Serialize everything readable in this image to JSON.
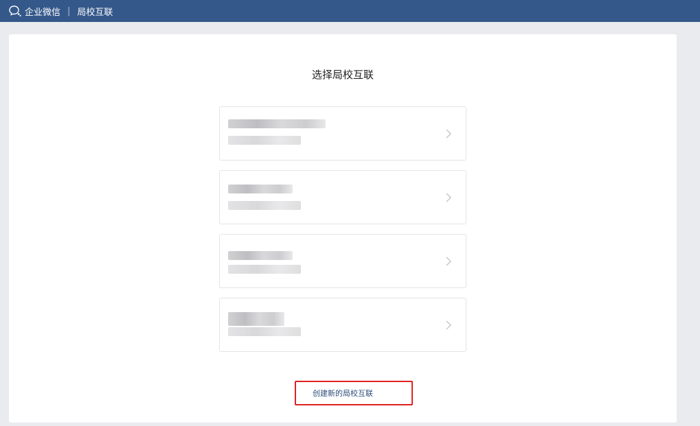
{
  "header": {
    "brand": "企业微信",
    "separator": "|",
    "section": "局校互联"
  },
  "main": {
    "title": "选择局校互联",
    "items": [
      {
        "label": "",
        "sub": ""
      },
      {
        "label": "",
        "sub": ""
      },
      {
        "label": "",
        "sub": ""
      },
      {
        "label": "",
        "sub": ""
      }
    ],
    "create_link": "创建新的局校互联"
  },
  "colors": {
    "header_bg": "#34588a",
    "highlight_border": "#e02020",
    "link": "#2e4f7a"
  }
}
